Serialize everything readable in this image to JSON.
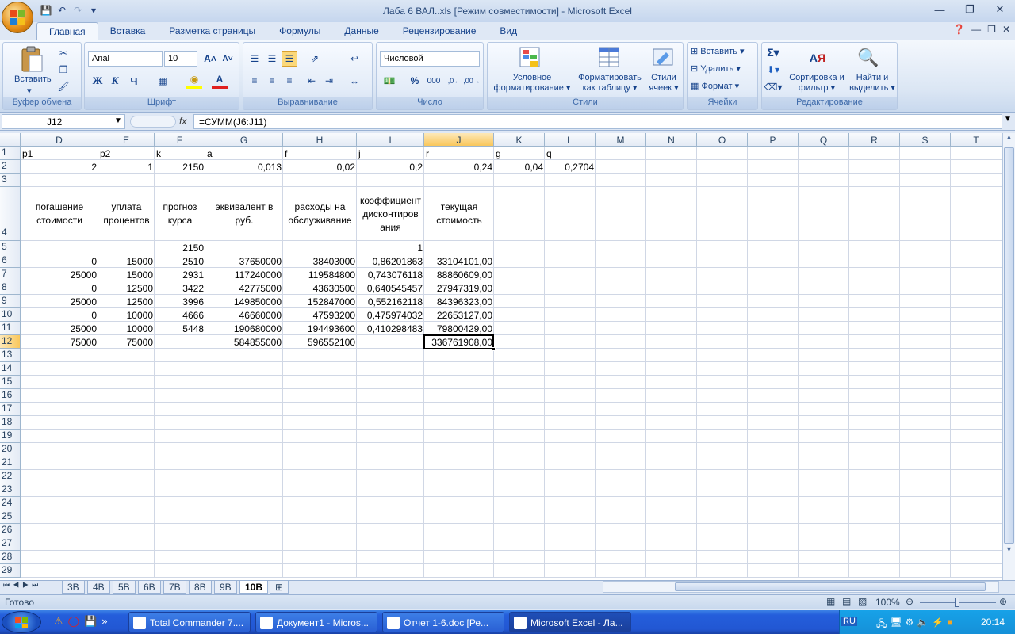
{
  "window": {
    "title": "Лаба 6 ВАЛ..xls  [Режим совместимости] - Microsoft Excel"
  },
  "ribbon": {
    "tabs": [
      "Главная",
      "Вставка",
      "Разметка страницы",
      "Формулы",
      "Данные",
      "Рецензирование",
      "Вид"
    ],
    "clipboard": {
      "label": "Буфер обмена",
      "paste": "Вставить"
    },
    "font": {
      "label": "Шрифт",
      "name": "Arial",
      "size": "10",
      "bold": "Ж",
      "italic": "К",
      "underline": "Ч"
    },
    "alignment": {
      "label": "Выравнивание"
    },
    "number": {
      "label": "Число",
      "format": "Числовой"
    },
    "styles": {
      "label": "Стили",
      "conditional": "Условное форматирование",
      "as_table": "Форматировать как таблицу",
      "cell_styles": "Стили ячеек"
    },
    "cells": {
      "label": "Ячейки",
      "insert": "Вставить",
      "delete": "Удалить",
      "format": "Формат"
    },
    "editing": {
      "label": "Редактирование",
      "sort": "Сортировка и фильтр",
      "find": "Найти и выделить"
    }
  },
  "formula_bar": {
    "name_box": "J12",
    "fx": "fx",
    "formula": "=СУММ(J6:J11)"
  },
  "grid": {
    "columns": [
      "D",
      "E",
      "F",
      "G",
      "H",
      "I",
      "J",
      "K",
      "L",
      "M",
      "N",
      "O",
      "P",
      "Q",
      "R",
      "S",
      "T"
    ],
    "row_numbers": [
      "1",
      "2",
      "3",
      "4",
      "5",
      "6",
      "7",
      "8",
      "9",
      "10",
      "11",
      "12",
      "13",
      "14",
      "15",
      "16",
      "17",
      "18",
      "19",
      "20",
      "21",
      "22",
      "23",
      "24",
      "25",
      "26",
      "27",
      "28",
      "29"
    ],
    "row1": [
      "p1",
      "p2",
      "k",
      "a",
      "f",
      "j",
      "r",
      "g",
      "q"
    ],
    "row2": [
      "2",
      "1",
      "2150",
      "0,013",
      "0,02",
      "0,2",
      "0,24",
      "0,04",
      "0,2704"
    ],
    "row4": [
      "погашение стоимости",
      "уплата процентов",
      "прогноз курса",
      "эквивалент в руб.",
      "расходы на обслуживание",
      "коэффициент дисконтиров ания",
      "текущая стоимость"
    ],
    "row5": {
      "F": "2150",
      "I": "1"
    },
    "data_rows": [
      [
        "0",
        "15000",
        "2510",
        "37650000",
        "38403000",
        "0,86201863",
        "33104101,00"
      ],
      [
        "25000",
        "15000",
        "2931",
        "117240000",
        "119584800",
        "0,743076118",
        "88860609,00"
      ],
      [
        "0",
        "12500",
        "3422",
        "42775000",
        "43630500",
        "0,640545457",
        "27947319,00"
      ],
      [
        "25000",
        "12500",
        "3996",
        "149850000",
        "152847000",
        "0,552162118",
        "84396323,00"
      ],
      [
        "0",
        "10000",
        "4666",
        "46660000",
        "47593200",
        "0,475974032",
        "22653127,00"
      ],
      [
        "25000",
        "10000",
        "5448",
        "190680000",
        "194493600",
        "0,410298483",
        "79800429,00"
      ]
    ],
    "totals": [
      "75000",
      "75000",
      "",
      "584855000",
      "596552100",
      "",
      "336761908,00"
    ]
  },
  "sheets": [
    "3В",
    "4В",
    "5В",
    "6В",
    "7В",
    "8В",
    "9В",
    "10В"
  ],
  "status": {
    "ready": "Готово",
    "zoom": "100%"
  },
  "taskbar": {
    "tasks": [
      "Total Commander 7....",
      "Документ1 - Micros...",
      "Отчет 1-6.doc [Ре...",
      "Microsoft Excel - Ла..."
    ],
    "lang": "RU",
    "clock": "20:14"
  }
}
